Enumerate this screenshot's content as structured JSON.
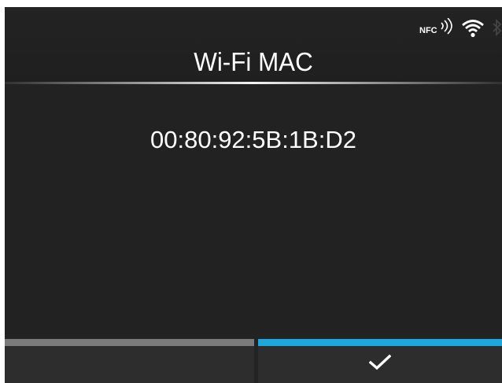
{
  "header": {
    "title": "Wi-Fi MAC"
  },
  "status": {
    "icons": [
      "nfc-icon",
      "wifi-icon",
      "bluetooth-icon"
    ],
    "nfc_label": "NFC"
  },
  "main": {
    "mac_address": "00:80:92:5B:1B:D2"
  },
  "soft_keys": {
    "left": {
      "label": "",
      "accent_color": "#7b7b7b"
    },
    "right": {
      "icon": "check-icon",
      "accent_color": "#1aa8df"
    }
  },
  "colors": {
    "background": "#232323",
    "text": "#ffffff",
    "accent_active": "#1aa8df",
    "accent_inactive": "#7b7b7b"
  }
}
